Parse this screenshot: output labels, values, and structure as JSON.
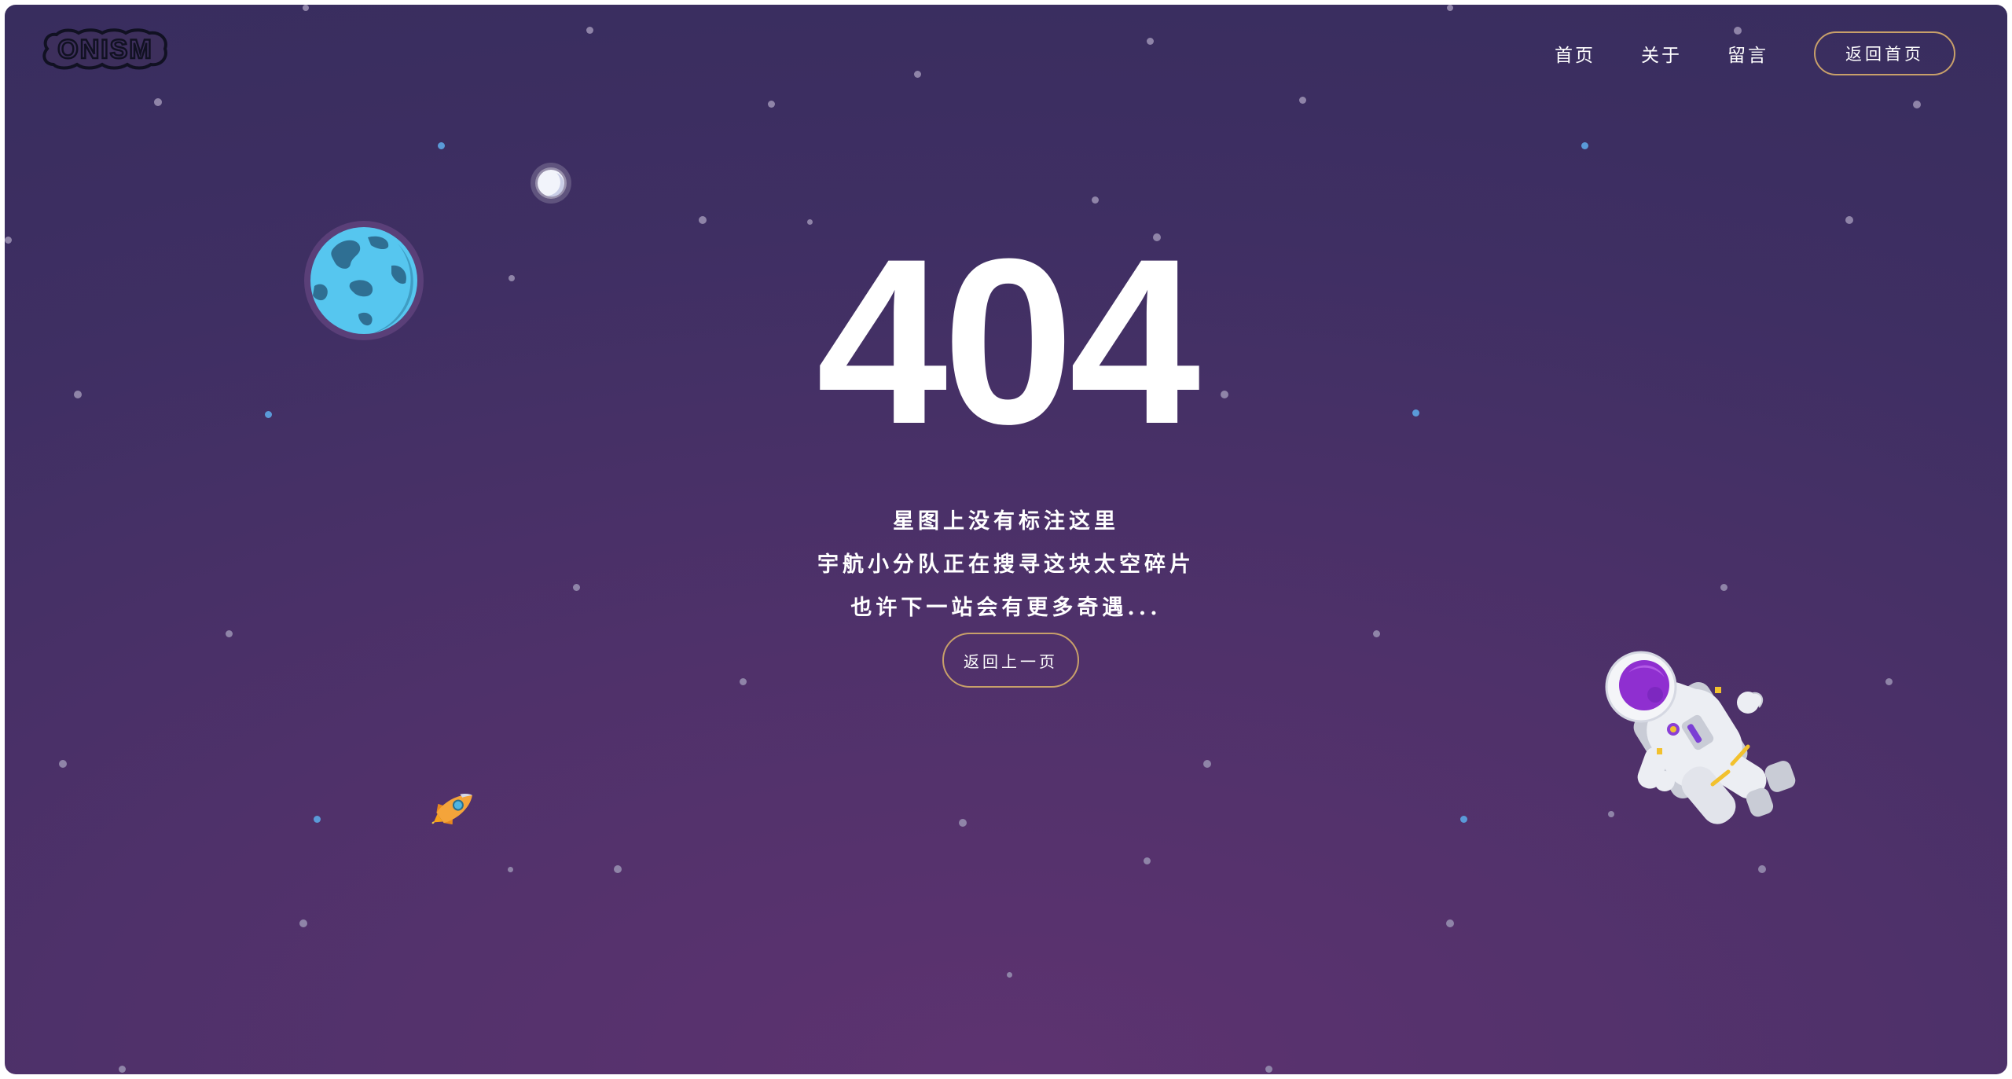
{
  "brand": {
    "logo_text": "ONISM"
  },
  "nav": {
    "items": [
      {
        "label": "首页"
      },
      {
        "label": "关于"
      },
      {
        "label": "留言"
      }
    ],
    "home_button_label": "返回首页"
  },
  "error": {
    "code": "404",
    "messages": [
      "星图上没有标注这里",
      "宇航小分队正在搜寻这块太空碎片",
      "也许下一站会有更多奇遇..."
    ],
    "back_button_label": "返回上一页"
  },
  "icons": {
    "planet": "planet-earth-icon",
    "moon": "moon-icon",
    "rocket": "rocket-icon",
    "astronaut": "astronaut-icon"
  },
  "colors": {
    "background_top": "#382d5e",
    "background_bottom": "#5d3370",
    "button_border": "#c8a06a",
    "text": "#ffffff",
    "planet": "#4fc3ee"
  }
}
